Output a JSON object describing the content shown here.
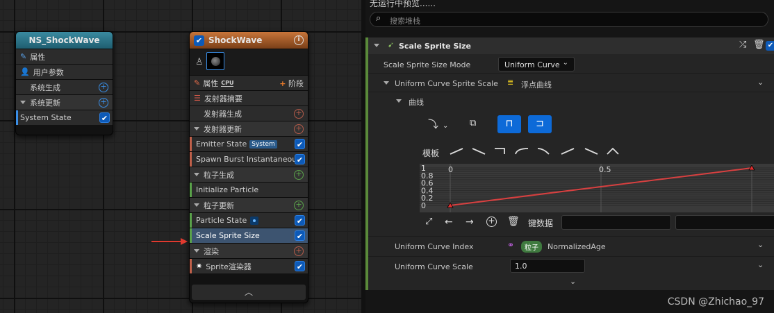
{
  "node_system": {
    "title": "NS_ShockWave",
    "rows": [
      "属性",
      "用户参数",
      "系统生成",
      "系统更新",
      "System State"
    ]
  },
  "node_emitter": {
    "title": "ShockWave",
    "tab_label": "属性",
    "cpu_label": "CPU",
    "stage_label": "阶段",
    "summary": "发射器摘要",
    "emitter_spawn": "发射器生成",
    "emitter_update": "发射器更新",
    "emitter_state": "Emitter State",
    "system_badge": "System",
    "spawn_burst": "Spawn Burst Instantaneous",
    "particle_spawn": "粒子生成",
    "init_particle": "Initialize Particle",
    "particle_update": "粒子更新",
    "particle_state": "Particle State",
    "scale_sprite": "Scale Sprite Size",
    "render": "渲染",
    "sprite_renderer": "Sprite渲染器"
  },
  "panel": {
    "status": "无运行中预览......",
    "search_placeholder": "搜索堆栈",
    "module_title": "Scale Sprite Size",
    "mode_label": "Scale Sprite Size Mode",
    "mode_value": "Uniform Curve",
    "curve_label": "Uniform Curve Sprite Scale",
    "curve_type": "浮点曲线",
    "curve_section": "曲线",
    "template_label": "模板",
    "key_data_label": "键数据",
    "index_label": "Uniform Curve Index",
    "index_badge": "粒子",
    "index_value": "NormalizedAge",
    "scale_label": "Uniform Curve Scale",
    "scale_value": "1.0"
  },
  "chart_data": {
    "type": "line",
    "x": [
      0,
      1
    ],
    "y": [
      0,
      1
    ],
    "x_ticks": [
      "0",
      "0.5"
    ],
    "y_ticks": [
      "1",
      "0.8",
      "0.6",
      "0.4",
      "0.2",
      "0"
    ],
    "line_color": "#d84040"
  },
  "watermark": "CSDN @Zhichao_97",
  "colors": {
    "accent": "#0d6ad8",
    "system_header": "#2f7a8f",
    "emitter_header": "#b8652a",
    "arrow": "#e03a2f"
  }
}
